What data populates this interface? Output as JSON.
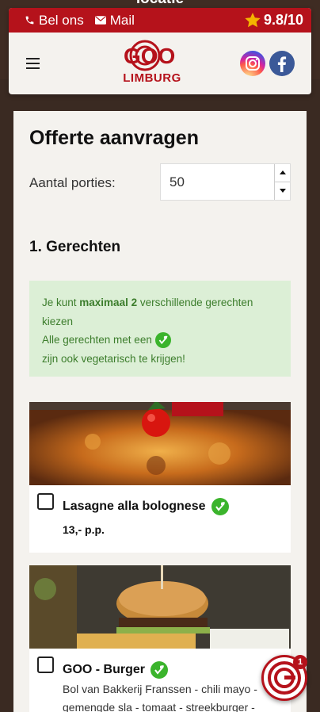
{
  "top_cut_text": "locatie",
  "contact": {
    "call_label": "Bel ons",
    "mail_label": "Mail",
    "rating": "9.8/10",
    "icons": [
      "phone-icon",
      "mail-icon",
      "star-icon"
    ]
  },
  "brand": {
    "logo_letters": "GOO",
    "logo_sub": "LIMBURG",
    "color": "#b5121b"
  },
  "social": [
    "instagram-icon",
    "facebook-icon"
  ],
  "form": {
    "title": "Offerte aanvragen",
    "portions_label": "Aantal porties:",
    "portions_value": "50",
    "section_title": "1. Gerechten",
    "info": {
      "line1_pre": "Je kunt ",
      "line1_bold": "maximaal 2",
      "line1_post": " verschillende gerechten kiezen",
      "line2": "Alle gerechten met een",
      "line3": "zijn ook vegetarisch te krijgen!"
    }
  },
  "dishes": [
    {
      "name": "Lasagne alla bolognese",
      "price": "13,- p.p.",
      "vegetarian_option": true,
      "checked": false
    },
    {
      "name": "GOO - Burger",
      "description": "Bol van Bakkerij Franssen - chili mayo - gemengde sla - tomaat - streekburger -",
      "vegetarian_option": true,
      "checked": false
    }
  ],
  "fab": {
    "badge_count": "1"
  },
  "colors": {
    "accent": "#b5121b",
    "veg_green": "#3bb42c",
    "info_bg": "#dcefd6"
  }
}
